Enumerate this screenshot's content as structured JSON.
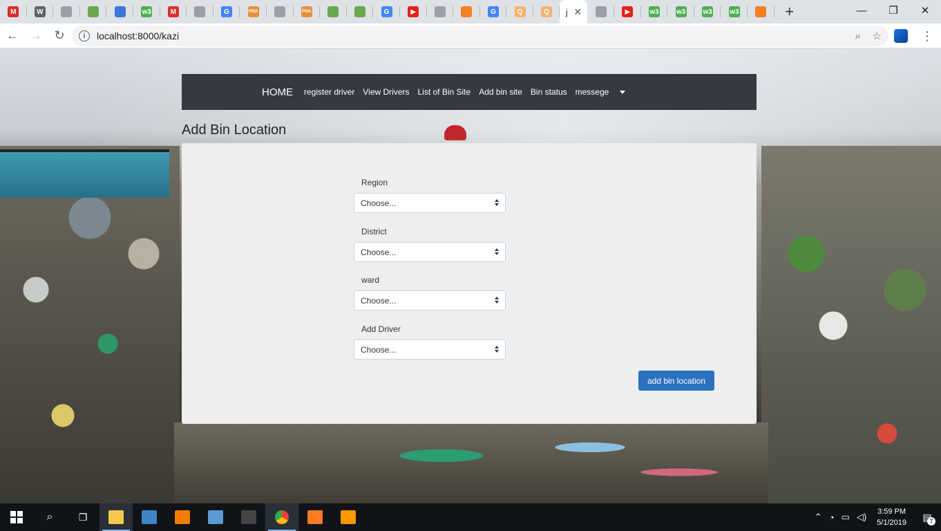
{
  "browser": {
    "tabs": [
      {
        "icon": "gmail-icon",
        "glyph": "M",
        "color": "#d93025"
      },
      {
        "icon": "wordpress-icon",
        "glyph": "W",
        "color": "#5f6368"
      },
      {
        "icon": "document-icon",
        "glyph": "",
        "color": "#9aa0a6"
      },
      {
        "icon": "leaf-icon",
        "glyph": "",
        "color": "#6aa84f"
      },
      {
        "icon": "puzzle-icon",
        "glyph": "",
        "color": "#3c78d8"
      },
      {
        "icon": "w3-icon",
        "glyph": "w3",
        "color": "#4caf50"
      },
      {
        "icon": "gmail-icon",
        "glyph": "M",
        "color": "#d93025"
      },
      {
        "icon": "document-icon",
        "glyph": "",
        "color": "#9aa0a6"
      },
      {
        "icon": "google-icon",
        "glyph": "G",
        "color": "#4285f4"
      },
      {
        "icon": "phpmyadmin-icon",
        "glyph": "PMA",
        "color": "#e69138"
      },
      {
        "icon": "document-icon",
        "glyph": "",
        "color": "#9aa0a6"
      },
      {
        "icon": "phpmyadmin-icon",
        "glyph": "PMA",
        "color": "#e69138"
      },
      {
        "icon": "leaf-icon",
        "glyph": "",
        "color": "#6aa84f"
      },
      {
        "icon": "download-icon",
        "glyph": "",
        "color": "#6aa84f"
      },
      {
        "icon": "google-icon",
        "glyph": "G",
        "color": "#4285f4"
      },
      {
        "icon": "youtube-icon",
        "glyph": "▶",
        "color": "#e62117"
      },
      {
        "icon": "document-icon",
        "glyph": "",
        "color": "#9aa0a6"
      },
      {
        "icon": "stackoverflow-icon",
        "glyph": "",
        "color": "#f48024"
      },
      {
        "icon": "google-icon",
        "glyph": "G",
        "color": "#4285f4"
      },
      {
        "icon": "search-orange-icon",
        "glyph": "Q",
        "color": "#f6b26b"
      },
      {
        "icon": "search-orange-icon",
        "glyph": "Q",
        "color": "#f6b26b"
      }
    ],
    "active_tab": {
      "label": "j",
      "close": "✕"
    },
    "tabs_after": [
      {
        "icon": "globe-icon",
        "glyph": "",
        "color": "#9aa0a6"
      },
      {
        "icon": "youtube-icon",
        "glyph": "▶",
        "color": "#e62117"
      },
      {
        "icon": "w3-icon",
        "glyph": "w3",
        "color": "#4caf50"
      },
      {
        "icon": "w3-icon",
        "glyph": "w3",
        "color": "#4caf50"
      },
      {
        "icon": "w3-icon",
        "glyph": "w3",
        "color": "#4caf50"
      },
      {
        "icon": "w3-icon",
        "glyph": "w3",
        "color": "#4caf50"
      },
      {
        "icon": "stackoverflow-icon",
        "glyph": "",
        "color": "#f48024"
      }
    ],
    "new_tab": "+",
    "window_controls": {
      "minimize": "—",
      "restore": "❐",
      "close": "✕"
    },
    "url": "localhost:8000/kazi"
  },
  "navbar": {
    "brand": "HOME",
    "links": [
      "register driver",
      "View Drivers",
      "List of Bin Site",
      "Add bin site",
      "Bin status",
      "messege"
    ]
  },
  "page": {
    "title": "Add Bin Location",
    "fields": [
      {
        "label": "Region",
        "value": "Choose..."
      },
      {
        "label": "District",
        "value": "Choose..."
      },
      {
        "label": "ward",
        "value": "Choose..."
      },
      {
        "label": "Add Driver",
        "value": "Choose..."
      }
    ],
    "submit": "add bin location"
  },
  "taskbar": {
    "time": "3:59 PM",
    "date": "5/1/2019",
    "notifications": "7",
    "apps": [
      {
        "name": "file-explorer-icon",
        "color": "#f2c94c",
        "active": true
      },
      {
        "name": "media-player-icon",
        "color": "#3d85c6",
        "active": false
      },
      {
        "name": "vlc-icon",
        "color": "#f57c00",
        "active": false
      },
      {
        "name": "file-manager-icon",
        "color": "#5b9bd5",
        "active": false
      },
      {
        "name": "terminal-icon",
        "color": "#444444",
        "active": false
      },
      {
        "name": "chrome-icon",
        "color": "#34a853",
        "active": true
      },
      {
        "name": "xampp-icon",
        "color": "#fb7a24",
        "active": false
      },
      {
        "name": "sublime-icon",
        "color": "#ff9800",
        "active": false
      }
    ]
  }
}
